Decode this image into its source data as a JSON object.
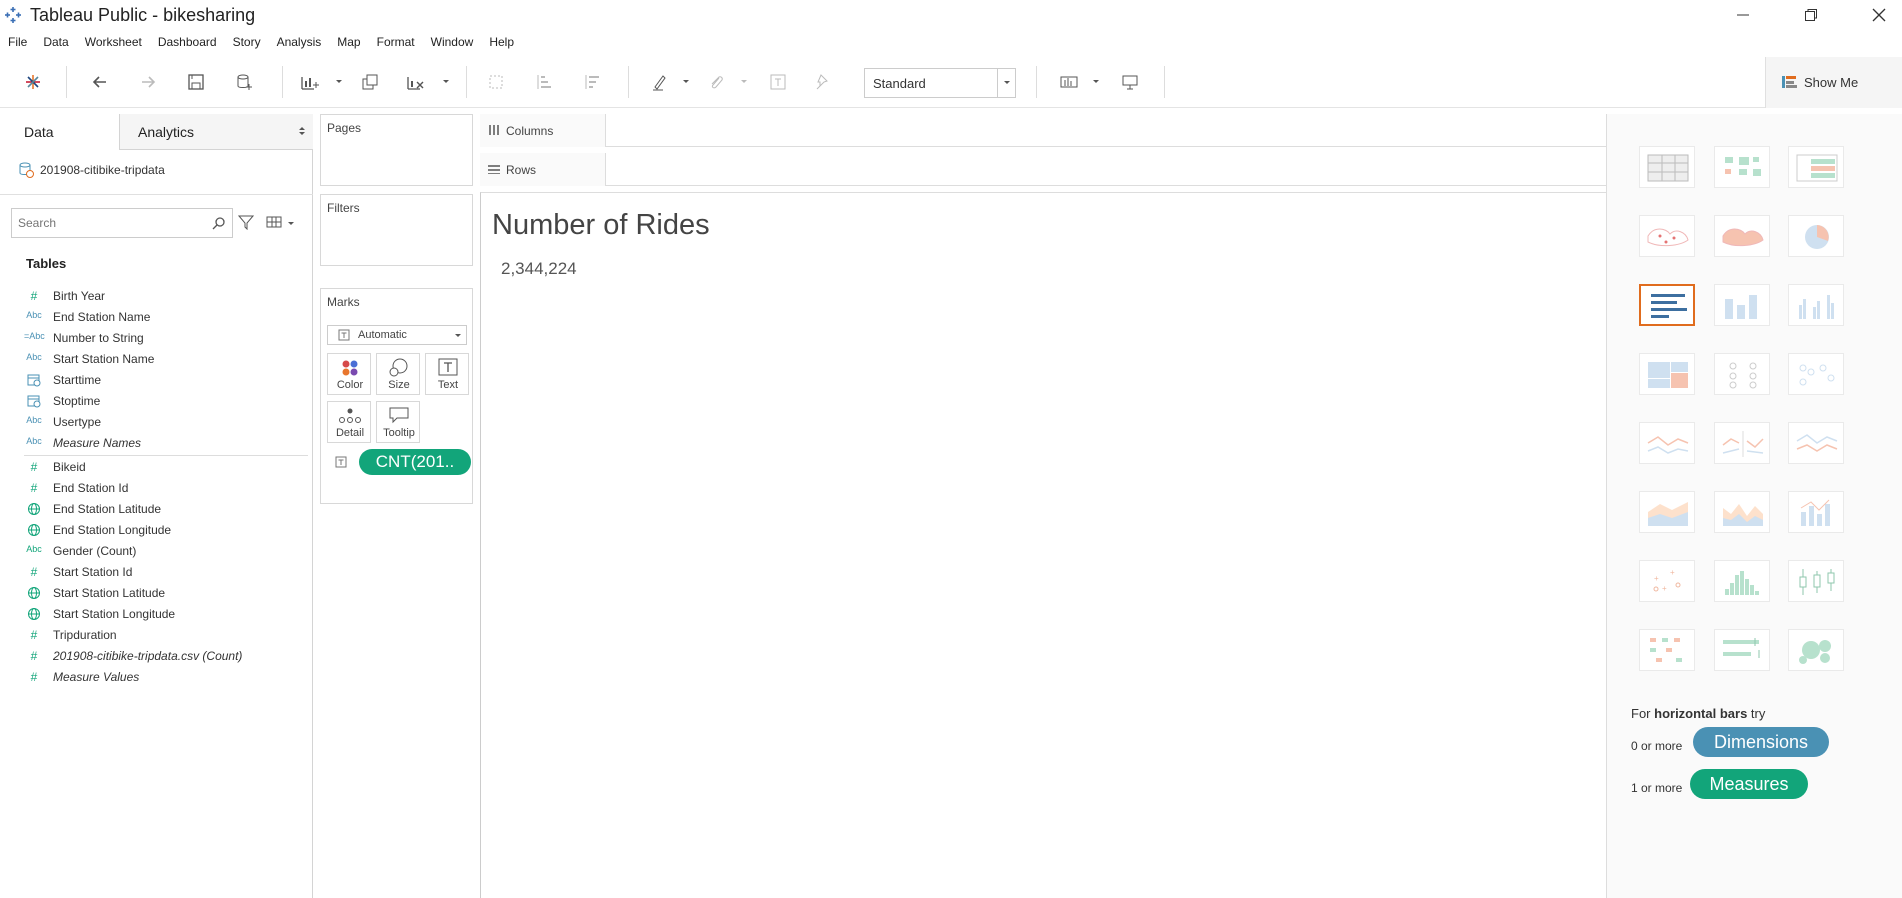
{
  "window": {
    "title": "Tableau Public - bikesharing"
  },
  "menu": [
    "File",
    "Data",
    "Worksheet",
    "Dashboard",
    "Story",
    "Analysis",
    "Map",
    "Format",
    "Window",
    "Help"
  ],
  "toolbar": {
    "fit_select": "Standard",
    "show_me_label": "Show Me"
  },
  "datapane": {
    "tab_data": "Data",
    "tab_analytics": "Analytics",
    "datasource": "201908-citibike-tripdata",
    "search_placeholder": "Search",
    "tables_header": "Tables",
    "fields": [
      {
        "icon": "#",
        "label": "Birth Year",
        "type": "measure"
      },
      {
        "icon": "Abc",
        "label": "End Station Name",
        "type": "dimension"
      },
      {
        "icon": "=Abc",
        "label": "Number to String",
        "type": "dimension"
      },
      {
        "icon": "Abc",
        "label": "Start Station Name",
        "type": "dimension"
      },
      {
        "icon": "date",
        "label": "Starttime",
        "type": "dimension"
      },
      {
        "icon": "date",
        "label": "Stoptime",
        "type": "dimension"
      },
      {
        "icon": "Abc",
        "label": "Usertype",
        "type": "dimension"
      },
      {
        "icon": "Abc",
        "label": "Measure Names",
        "type": "dimension"
      },
      {
        "icon": "#",
        "label": "Bikeid",
        "type": "measure"
      },
      {
        "icon": "#",
        "label": "End Station Id",
        "type": "measure"
      },
      {
        "icon": "globe",
        "label": "End Station Latitude",
        "type": "measure"
      },
      {
        "icon": "globe",
        "label": "End Station Longitude",
        "type": "measure"
      },
      {
        "icon": "Abc",
        "label": "Gender (Count)",
        "type": "measure"
      },
      {
        "icon": "#",
        "label": "Start Station Id",
        "type": "measure"
      },
      {
        "icon": "globe",
        "label": "Start Station Latitude",
        "type": "measure"
      },
      {
        "icon": "globe",
        "label": "Start Station Longitude",
        "type": "measure"
      },
      {
        "icon": "#",
        "label": "Tripduration",
        "type": "measure"
      },
      {
        "icon": "#",
        "label": "201908-citibike-tripdata.csv (Count)",
        "type": "measure"
      },
      {
        "icon": "#",
        "label": "Measure Values",
        "type": "measure"
      }
    ]
  },
  "cards": {
    "pages": "Pages",
    "filters": "Filters",
    "marks": "Marks",
    "mark_type": "Automatic",
    "color": "Color",
    "size": "Size",
    "text": "Text",
    "detail": "Detail",
    "tooltip": "Tooltip",
    "pill": "CNT(201.."
  },
  "shelves": {
    "columns": "Columns",
    "rows": "Rows"
  },
  "view": {
    "title": "Number of Rides",
    "value": "2,344,224"
  },
  "showme": {
    "hint_prefix": "For ",
    "hint_bold": "horizontal bars",
    "hint_suffix": " try",
    "dims_prefix": "0 or more",
    "dims_pill": "Dimensions",
    "meas_prefix": "1 or more",
    "meas_pill": "Measures",
    "colors": {
      "dimension": "#4a91b4",
      "measure": "#12a57a",
      "active": "#e06c1e"
    }
  }
}
